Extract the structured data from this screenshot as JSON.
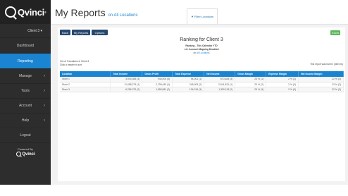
{
  "brand": {
    "name": "Qvinci",
    "tm": "®"
  },
  "sidebar": {
    "client": "Client 3 ▾",
    "items": [
      {
        "label": "Dashboard"
      },
      {
        "label": "Reporting"
      },
      {
        "label": "Manage",
        "chevron": "›"
      },
      {
        "label": "Tools",
        "chevron": "›"
      },
      {
        "label": "Account",
        "chevron": "›"
      },
      {
        "label": "Help",
        "chevron": "›"
      },
      {
        "label": "Logout"
      }
    ],
    "powered_by": "Powered By"
  },
  "header": {
    "title": "My Reports",
    "subtitle": "on All Locations",
    "filter_icon": "▼",
    "filter_label": "Filter Locations"
  },
  "toolbar": {
    "back": "Back",
    "my_reports": "My Reports",
    "options": "Options",
    "excel": "Excel"
  },
  "report": {
    "title": "Ranking for Client 3",
    "line1": "Ranking - This Calendar YTD",
    "line2_pre": "with ",
    "line2_bold": "Account Mapping Disabled",
    "line3_pre": "on ",
    "line3_link": "All Locations",
    "count_note": "Out of 3 locations in Client 3",
    "sort_note": "Click a header to sort",
    "built_note": "This report was built in (380 ms)"
  },
  "table": {
    "columns": [
      "Location",
      "Total Income",
      "Gross Profit",
      "Total Expense",
      "Net Income",
      "Gross Margin",
      "Expense Margin",
      "Net Income Margin"
    ],
    "rows": [
      [
        "Store 1",
        "3,930,355 (3)",
        "944,904 (3)",
        "94,001 (1)",
        "870,483 (3)",
        "23 % (1)",
        "2 % (1)",
        "22 % (1)"
      ],
      [
        "Store 2",
        "11,058,275 (1)",
        "2,798,483 (1)",
        "245,003 (2)",
        "2,541,831 (1)",
        "23 % (2)",
        "2 % (2)",
        "23 % (2)"
      ],
      [
        "Store 3",
        "6,256,792 (2)",
        "1,555,881 (2)",
        "134,019 (3)",
        "1,390,118 (2)",
        "23 % (3)",
        "2 % (3)",
        "22 % (3)"
      ]
    ]
  },
  "colors": {
    "sidebar_bg": "#2d2d2d",
    "accent": "#1b84d0",
    "button": "#26486e",
    "excel": "#5cb85c"
  }
}
